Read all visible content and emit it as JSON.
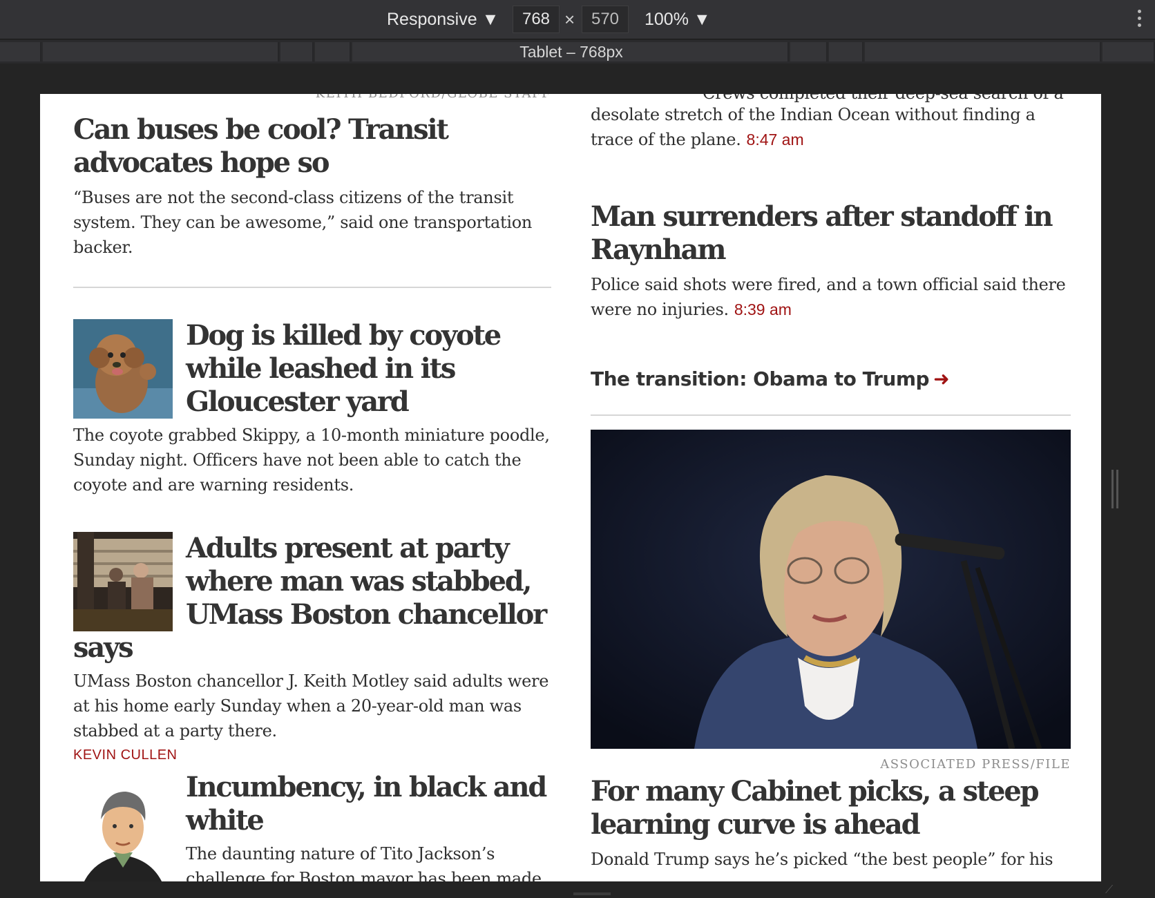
{
  "devtools": {
    "device_mode": "Responsive ▼",
    "width": "768",
    "dim_separator": "×",
    "height": "570",
    "zoom": "100% ▼",
    "media_query_label": "Tablet – 768px"
  },
  "left_column": {
    "top_credit": "KEITH BEDFORD/GLOBE STAFF",
    "story1": {
      "headline": "Can buses be cool? Transit advocates hope so",
      "dek": "“Buses are not the second-class citizens of the transit system. They can be awesome,” said one transportation backer."
    },
    "story2": {
      "headline": "Dog is killed by coyote while leashed in its Gloucester yard",
      "dek": "The coyote grabbed Skippy, a 10-month miniature poodle, Sunday night. Officers have not been able to catch the coyote and are warning residents."
    },
    "story3": {
      "headline": "Adults present at party where man was stabbed, UMass Boston chancellor says",
      "dek": "UMass Boston chancellor J. Keith Motley said adults were at his home early Sunday when a 20-year-old man was stabbed at a party there."
    },
    "story4": {
      "kicker": "KEVIN CULLEN",
      "headline": "Incumbency, in black and white",
      "dek": "The daunting nature of Tito Jackson’s challenge for Boston mayor has been made clear in recent days."
    }
  },
  "right_column": {
    "story1": {
      "dek_top_line": "Crews completed their deep-sea search of a",
      "dek": "desolate stretch of the Indian Ocean without finding a trace of the plane.",
      "time": "8:47 am"
    },
    "story2": {
      "headline": "Man surrenders after standoff in Raynham",
      "dek": "Police said shots were fired, and a town official said there were no injuries.",
      "time": "8:39 am"
    },
    "section_link": {
      "label": "The transition: Obama to Trump",
      "arrow": "➜"
    },
    "feature": {
      "photo_credit": "ASSOCIATED PRESS/FILE",
      "headline": "For many Cabinet picks, a steep learning curve is ahead",
      "dek": "Donald Trump says he’s picked “the best people” for his"
    }
  },
  "colors": {
    "accent_red": "#a01414",
    "headline": "#333333",
    "body_text": "#2f2f2f",
    "devtools_bg": "#333336"
  }
}
